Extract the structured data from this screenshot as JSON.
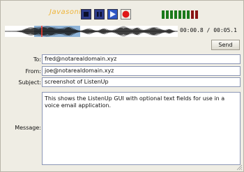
{
  "app": {
    "logo_text": "Javasonics"
  },
  "transport": {
    "buttons": [
      {
        "name": "stop-button",
        "icon": "stop-icon",
        "color": "#2d3c8a"
      },
      {
        "name": "pause-button",
        "icon": "pause-icon",
        "color": "#2d3c8a"
      },
      {
        "name": "play-button",
        "icon": "play-icon",
        "color": "#2d3c8a"
      },
      {
        "name": "record-button",
        "icon": "record-icon",
        "color": "#e01818"
      }
    ],
    "level_meter": {
      "green": "#1a7a1a",
      "red": "#8a1414",
      "active_segments": 9,
      "total_segments": 9
    }
  },
  "waveform": {
    "selection_color": "#8fb4d8",
    "playhead_color": "#ff3a2a"
  },
  "time": {
    "current": "00:00.8",
    "separator": "/",
    "total": "00:05.1"
  },
  "send_button": {
    "label": "Send"
  },
  "form": {
    "to": {
      "label": "To:",
      "value": "fred@notarealdomain.xyz"
    },
    "from": {
      "label": "From:",
      "value": "joe@notarealdomain.xyz"
    },
    "subject": {
      "label": "Subject:",
      "value": "screenshot of ListenUp"
    },
    "message": {
      "label": "Message:",
      "value": "This shows the ListenUp GUI with optional text fields for use in a voice email application."
    }
  }
}
